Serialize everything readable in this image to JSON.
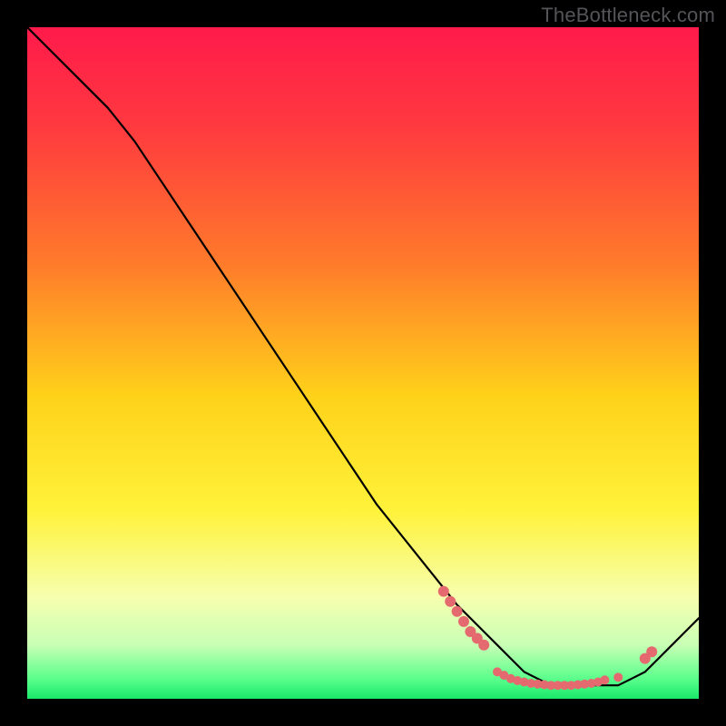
{
  "watermark": "TheBottleneck.com",
  "chart_data": {
    "type": "line",
    "title": "",
    "xlabel": "",
    "ylabel": "",
    "xlim": [
      0,
      100
    ],
    "ylim": [
      0,
      100
    ],
    "gradient_stops": [
      {
        "offset": 0.0,
        "color": "#ff1a4b"
      },
      {
        "offset": 0.15,
        "color": "#ff3a3f"
      },
      {
        "offset": 0.35,
        "color": "#ff7a2b"
      },
      {
        "offset": 0.55,
        "color": "#ffd21a"
      },
      {
        "offset": 0.72,
        "color": "#fff23a"
      },
      {
        "offset": 0.85,
        "color": "#f6ffb0"
      },
      {
        "offset": 0.92,
        "color": "#c8ffb4"
      },
      {
        "offset": 0.97,
        "color": "#5bff8c"
      },
      {
        "offset": 1.0,
        "color": "#19e86b"
      }
    ],
    "series": [
      {
        "name": "bottleneck-curve",
        "color": "#000000",
        "x": [
          0,
          4,
          8,
          12,
          16,
          20,
          24,
          28,
          32,
          36,
          40,
          44,
          48,
          52,
          56,
          60,
          64,
          68,
          70,
          72,
          74,
          76,
          78,
          80,
          82,
          84,
          86,
          88,
          90,
          92,
          94,
          96,
          98,
          100
        ],
        "y": [
          100,
          96,
          92,
          88,
          83,
          77,
          71,
          65,
          59,
          53,
          47,
          41,
          35,
          29,
          24,
          19,
          14,
          10,
          8,
          6,
          4,
          3,
          2,
          2,
          2,
          2,
          2,
          2,
          3,
          4,
          6,
          8,
          10,
          12
        ]
      }
    ],
    "marker_clusters": [
      {
        "name": "left-cluster",
        "color": "#e46a6f",
        "radius": 6,
        "points": [
          {
            "x": 62,
            "y": 16
          },
          {
            "x": 63,
            "y": 14.5
          },
          {
            "x": 64,
            "y": 13
          },
          {
            "x": 65,
            "y": 11.5
          },
          {
            "x": 66,
            "y": 10
          },
          {
            "x": 67,
            "y": 9
          },
          {
            "x": 68,
            "y": 8
          }
        ]
      },
      {
        "name": "bottom-cluster",
        "color": "#e46a6f",
        "radius": 5,
        "points": [
          {
            "x": 70,
            "y": 4
          },
          {
            "x": 71,
            "y": 3.5
          },
          {
            "x": 72,
            "y": 3
          },
          {
            "x": 73,
            "y": 2.7
          },
          {
            "x": 74,
            "y": 2.5
          },
          {
            "x": 75,
            "y": 2.3
          },
          {
            "x": 76,
            "y": 2.2
          },
          {
            "x": 77,
            "y": 2.1
          },
          {
            "x": 78,
            "y": 2.0
          },
          {
            "x": 79,
            "y": 2.0
          },
          {
            "x": 80,
            "y": 2.0
          },
          {
            "x": 81,
            "y": 2.0
          },
          {
            "x": 82,
            "y": 2.1
          },
          {
            "x": 83,
            "y": 2.2
          },
          {
            "x": 84,
            "y": 2.3
          },
          {
            "x": 85,
            "y": 2.5
          },
          {
            "x": 86,
            "y": 2.8
          },
          {
            "x": 88,
            "y": 3.2
          }
        ]
      },
      {
        "name": "right-cluster",
        "color": "#e46a6f",
        "radius": 6,
        "points": [
          {
            "x": 92,
            "y": 6
          },
          {
            "x": 93,
            "y": 7
          }
        ]
      }
    ]
  }
}
